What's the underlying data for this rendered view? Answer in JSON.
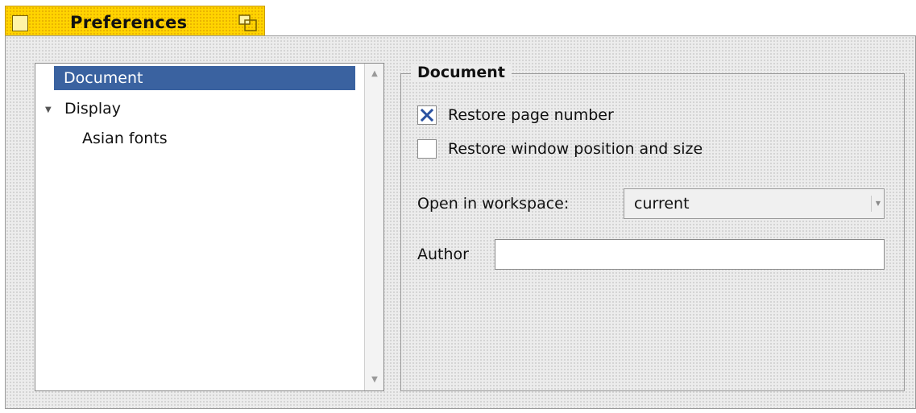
{
  "tab": {
    "title": "Preferences"
  },
  "tree": {
    "items": [
      {
        "label": "Document",
        "selected": true
      },
      {
        "label": "Display",
        "expanded": true
      },
      {
        "label": "Asian fonts"
      }
    ]
  },
  "document_group": {
    "title": "Document",
    "restore_page_number": {
      "label": "Restore page number",
      "checked": true
    },
    "restore_window": {
      "label": "Restore window position and size",
      "checked": false
    },
    "open_in_workspace": {
      "label": "Open in workspace:",
      "value": "current"
    },
    "author": {
      "label": "Author",
      "value": ""
    }
  },
  "colors": {
    "tab_yellow": "#ffd400",
    "selection_blue": "#3a62a0",
    "checkmark": "#2850a0"
  },
  "icons": {
    "tab_close": "close-box-icon",
    "tab_zoom": "zoom-icon",
    "expander": "chevron-down-icon",
    "checkmark": "x-check-icon",
    "combo_arrow": "dropdown-arrow-icon"
  }
}
